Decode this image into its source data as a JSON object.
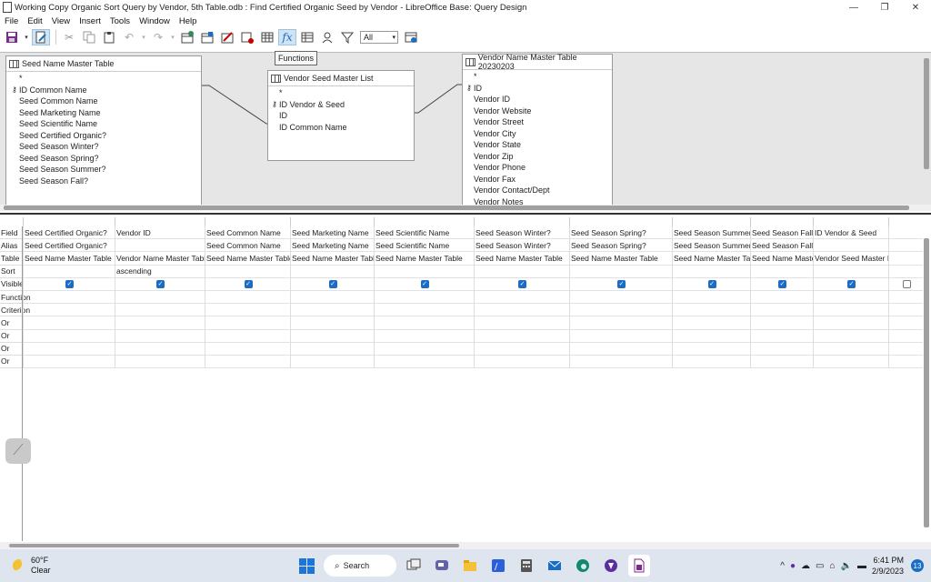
{
  "window": {
    "title": "Working Copy Organic Sort Query by Vendor, 5th Table.odb : Find Certified Organic Seed by Vendor - LibreOffice Base: Query Design",
    "controls": [
      "—",
      "❐",
      "✕"
    ]
  },
  "menu": [
    {
      "label": "File"
    },
    {
      "label": "Edit"
    },
    {
      "label": "View"
    },
    {
      "label": "Insert"
    },
    {
      "label": "Tools"
    },
    {
      "label": "Window"
    },
    {
      "label": "Help"
    }
  ],
  "toolbar": {
    "limit_value": "All",
    "tooltip": "Functions"
  },
  "tables": [
    {
      "title": "Seed Name Master Table",
      "fields": [
        {
          "label": "*",
          "key": false
        },
        {
          "label": "ID Common Name",
          "key": true
        },
        {
          "label": "Seed Common Name",
          "key": false
        },
        {
          "label": "Seed Marketing Name",
          "key": false
        },
        {
          "label": "Seed Scientific Name",
          "key": false
        },
        {
          "label": "Seed Certified Organic?",
          "key": false
        },
        {
          "label": "Seed Season Winter?",
          "key": false
        },
        {
          "label": "Seed Season Spring?",
          "key": false
        },
        {
          "label": "Seed Season Summer?",
          "key": false
        },
        {
          "label": "Seed Season Fall?",
          "key": false
        }
      ]
    },
    {
      "title": "Vendor Seed Master List",
      "fields": [
        {
          "label": "*",
          "key": false
        },
        {
          "label": "ID Vendor & Seed",
          "key": true
        },
        {
          "label": "ID",
          "key": false
        },
        {
          "label": "ID Common Name",
          "key": false
        }
      ]
    },
    {
      "title": "Vendor Name Master Table 20230203",
      "fields": [
        {
          "label": "*",
          "key": false
        },
        {
          "label": "ID",
          "key": true
        },
        {
          "label": "Vendor ID",
          "key": false
        },
        {
          "label": "Vendor Website",
          "key": false
        },
        {
          "label": "Vendor Street",
          "key": false
        },
        {
          "label": "Vendor City",
          "key": false
        },
        {
          "label": "Vendor State",
          "key": false
        },
        {
          "label": "Vendor Zip",
          "key": false
        },
        {
          "label": "Vendor Phone",
          "key": false
        },
        {
          "label": "Vendor Fax",
          "key": false
        },
        {
          "label": "Vendor Contact/Dept",
          "key": false
        },
        {
          "label": "Vendor Notes",
          "key": false
        }
      ]
    }
  ],
  "grid": {
    "row_labels": [
      "Field",
      "Alias",
      "Table",
      "Sort",
      "Visible",
      "Function",
      "Criterion",
      "Or",
      "Or",
      "Or",
      "Or"
    ],
    "columns": [
      {
        "field": "Seed Certified Organic?",
        "alias": "Seed Certified Organic?",
        "table": "Seed Name Master Table",
        "sort": "",
        "visible": true
      },
      {
        "field": "Vendor ID",
        "alias": "",
        "table": "Vendor Name Master Table",
        "sort": "ascending",
        "visible": true
      },
      {
        "field": "Seed Common Name",
        "alias": "Seed Common Name",
        "table": "Seed Name Master Table",
        "sort": "",
        "visible": true
      },
      {
        "field": "Seed Marketing Name",
        "alias": "Seed Marketing Name",
        "table": "Seed Name Master Table",
        "sort": "",
        "visible": true
      },
      {
        "field": "Seed Scientific Name",
        "alias": "Seed Scientific Name",
        "table": "Seed Name Master Table",
        "sort": "",
        "visible": true
      },
      {
        "field": "Seed Season Winter?",
        "alias": "Seed Season Winter?",
        "table": "Seed Name Master Table",
        "sort": "",
        "visible": true
      },
      {
        "field": "Seed Season Spring?",
        "alias": "Seed Season Spring?",
        "table": "Seed Name Master Table",
        "sort": "",
        "visible": true
      },
      {
        "field": "Seed Season Summer?",
        "alias": "Seed Season Summer?",
        "table": "Seed Name Master Table",
        "sort": "",
        "visible": true
      },
      {
        "field": "Seed Season Fall?",
        "alias": "Seed Season Fall?",
        "table": "Seed Name Master Table",
        "sort": "",
        "visible": true
      },
      {
        "field": "ID Vendor & Seed",
        "alias": "",
        "table": "Vendor Seed Master List",
        "sort": "",
        "visible": true
      },
      {
        "field": "",
        "alias": "",
        "table": "",
        "sort": "",
        "visible": false
      }
    ]
  },
  "taskbar": {
    "temperature": "60°F",
    "condition": "Clear",
    "search_label": "Search",
    "time": "6:41 PM",
    "date": "2/9/2023",
    "notification_count": "13"
  },
  "colors": {
    "accent": "#1a6cc4",
    "design_bg": "#e6e6e6",
    "taskbar_bg": "#dfe5ee"
  }
}
